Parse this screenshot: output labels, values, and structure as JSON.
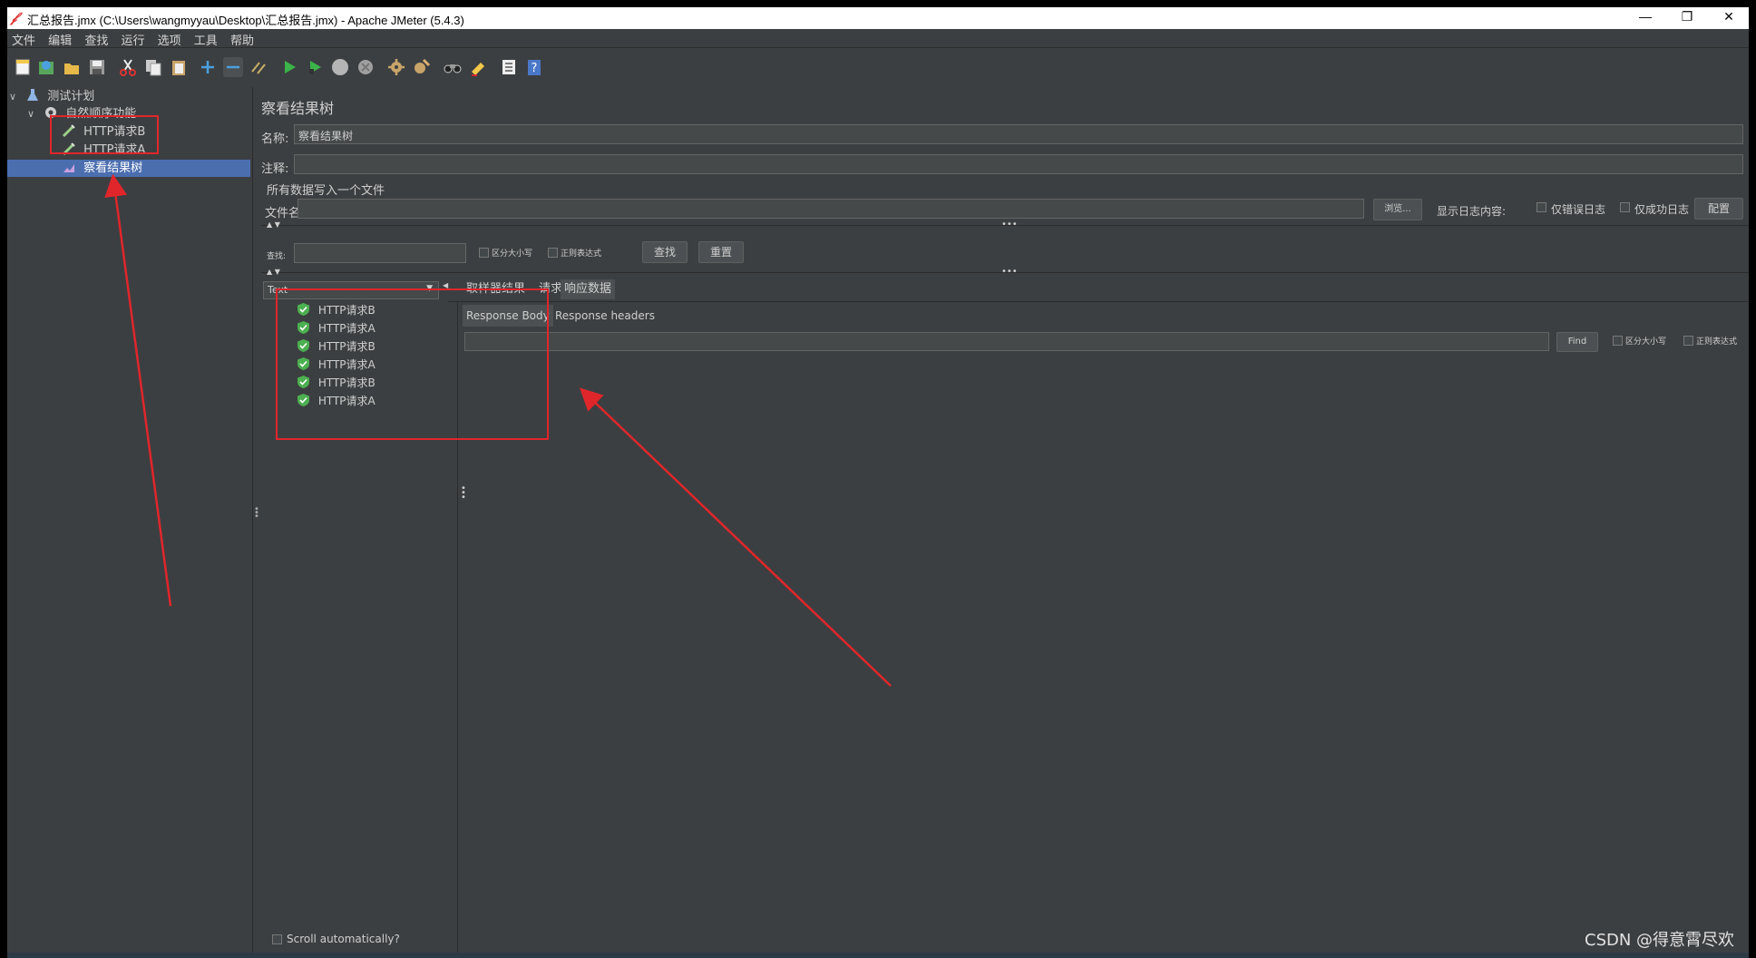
{
  "window": {
    "title": "汇总报告.jmx (C:\\Users\\wangmyyau\\Desktop\\汇总报告.jmx) - Apache JMeter (5.4.3)",
    "minimize": "—",
    "restore": "❐",
    "close": "✕"
  },
  "menu": [
    "文件",
    "编辑",
    "查找",
    "运行",
    "选项",
    "工具",
    "帮助"
  ],
  "toolbar_icons": [
    "new-icon",
    "templates-icon",
    "open-icon",
    "save-icon",
    "cut-icon",
    "copy-icon",
    "paste-icon",
    "expand-icon",
    "collapse-icon",
    "toggle-icon",
    "start-icon",
    "start-no-pause-icon",
    "stop-icon",
    "shutdown-icon",
    "clear-icon",
    "clear-all-icon",
    "search-icon",
    "reset-search-icon",
    "function-helper-icon",
    "help-icon"
  ],
  "tree": {
    "root": "测试计划",
    "group": "自然顺序功能",
    "items": [
      "HTTP请求B",
      "HTTP请求A"
    ],
    "listener": "察看结果树"
  },
  "panel": {
    "title": "察看结果树",
    "name_label": "名称:",
    "name_value": "察看结果树",
    "comment_label": "注释:",
    "comment_value": "",
    "file_section": "所有数据写入一个文件",
    "filename_label": "文件名",
    "filename_value": "",
    "browse_button": "浏览...",
    "log_content_label": "显示日志内容:",
    "errors_only": "仅错误日志",
    "success_only": "仅成功日志",
    "configure_button": "配置"
  },
  "search": {
    "label": "查找:",
    "value": "",
    "case_sensitive": "区分大小写",
    "regex": "正则表达式",
    "find_button": "查找",
    "reset_button": "重置"
  },
  "results": {
    "renderer": "Text",
    "samples": [
      "HTTP请求B",
      "HTTP请求A",
      "HTTP请求B",
      "HTTP请求A",
      "HTTP请求B",
      "HTTP请求A"
    ],
    "scroll_auto": "Scroll automatically?"
  },
  "detail": {
    "tabs": [
      "取样器结果",
      "请求",
      "响应数据"
    ],
    "subtabs": [
      "Response Body",
      "Response headers"
    ],
    "find_value": "",
    "find_button": "Find",
    "case_sensitive": "区分大小写",
    "regex": "正则表达式"
  },
  "watermark": "CSDN @得意霄尽欢",
  "colors": {
    "background": "#3c3f41",
    "selection": "#4b6eaf",
    "annotation": "#e0262b",
    "success": "#4caf50"
  }
}
